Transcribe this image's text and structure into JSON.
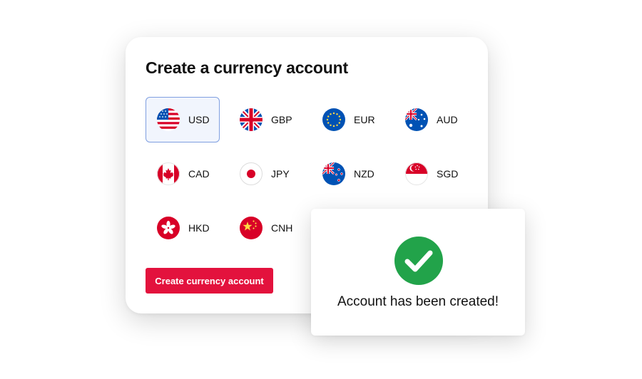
{
  "card": {
    "title": "Create a currency account",
    "button_label": "Create currency account"
  },
  "currencies": [
    {
      "code": "USD",
      "flag": "us-flag-icon",
      "selected": true
    },
    {
      "code": "GBP",
      "flag": "gb-flag-icon",
      "selected": false
    },
    {
      "code": "EUR",
      "flag": "eu-flag-icon",
      "selected": false
    },
    {
      "code": "AUD",
      "flag": "au-flag-icon",
      "selected": false
    },
    {
      "code": "CAD",
      "flag": "ca-flag-icon",
      "selected": false
    },
    {
      "code": "JPY",
      "flag": "jp-flag-icon",
      "selected": false
    },
    {
      "code": "NZD",
      "flag": "nz-flag-icon",
      "selected": false
    },
    {
      "code": "SGD",
      "flag": "sg-flag-icon",
      "selected": false
    },
    {
      "code": "HKD",
      "flag": "hk-flag-icon",
      "selected": false
    },
    {
      "code": "CNH",
      "flag": "cn-flag-icon",
      "selected": false
    }
  ],
  "toast": {
    "icon": "check-circle-icon",
    "message": "Account has been created!"
  },
  "colors": {
    "accent": "#e3123d",
    "success": "#22a34a",
    "selected_bg": "#f1f5fd",
    "selected_border": "#7f9fe0"
  }
}
